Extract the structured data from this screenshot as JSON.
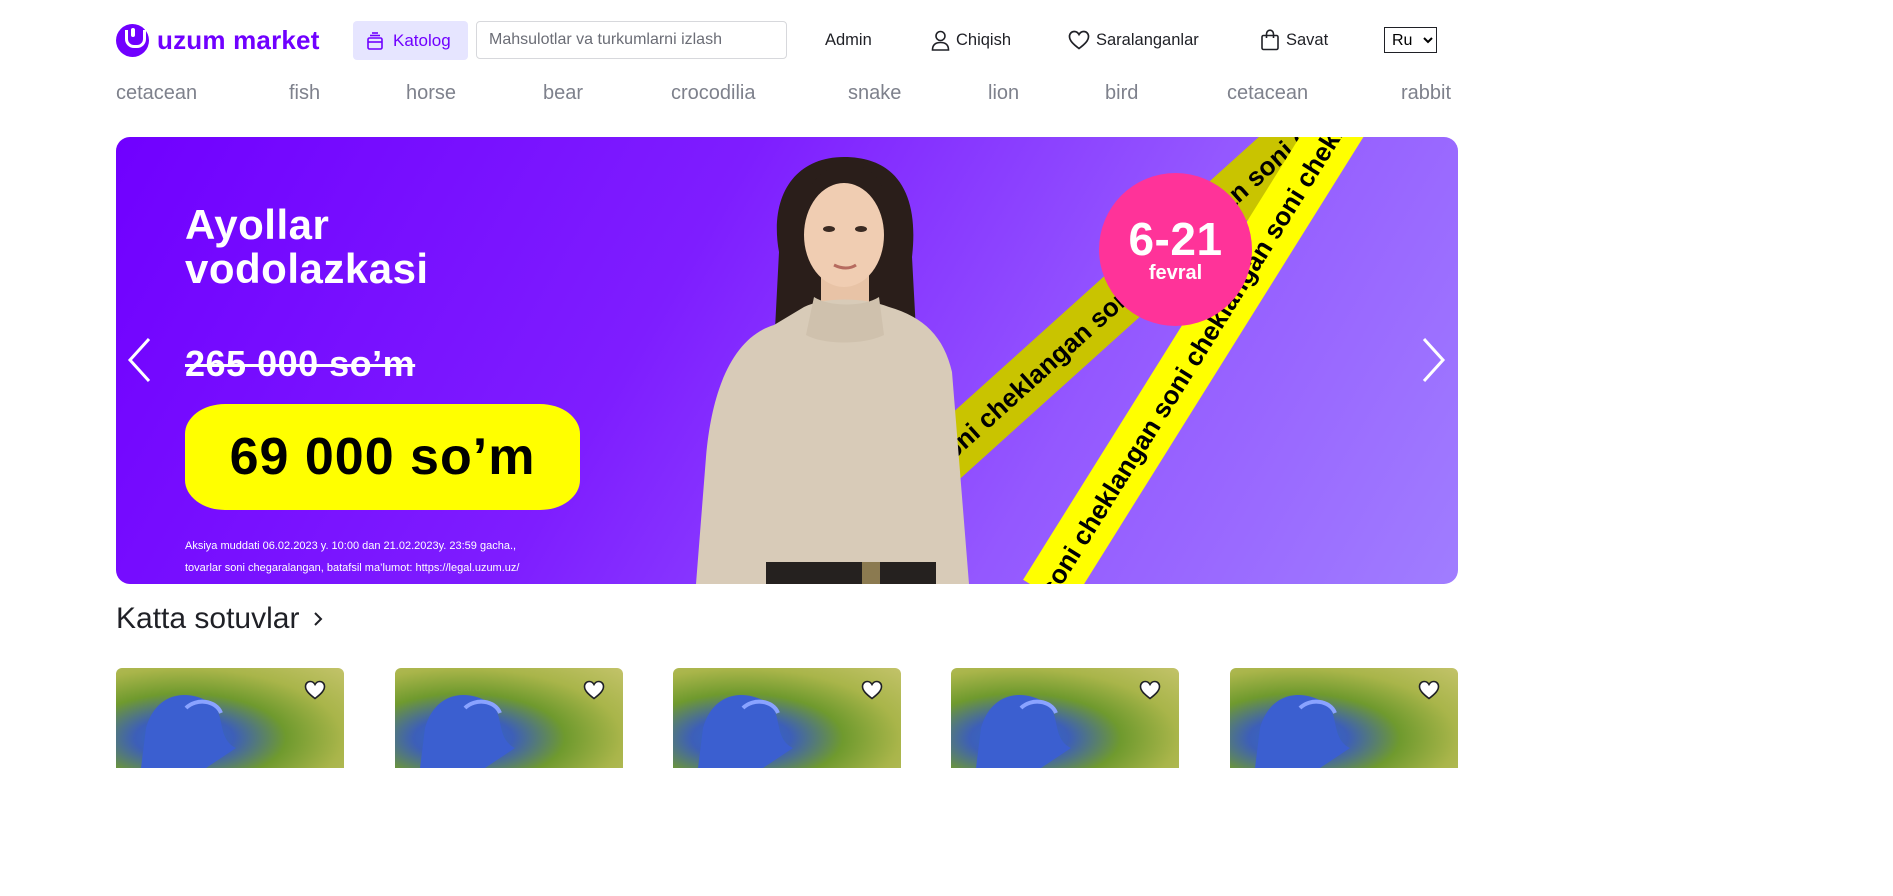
{
  "header": {
    "logo_text": "uzum market",
    "catalog_label": "Katolog",
    "search_placeholder": "Mahsulotlar va turkumlarni izlash",
    "admin_label": "Admin",
    "logout_label": "Chiqish",
    "favorites_label": "Saralanganlar",
    "cart_label": "Savat",
    "language": {
      "selected": "Ru"
    }
  },
  "categories": [
    "cetacean",
    "fish",
    "horse",
    "bear",
    "crocodilia",
    "snake",
    "lion",
    "bird",
    "cetacean",
    "rabbit"
  ],
  "banner": {
    "title_line1": "Ayollar",
    "title_line2": "vodolazkasi",
    "old_price": "265 000 so’m",
    "new_price": "69 000 so’m",
    "legal_line1": "Aksiya muddati 06.02.2023 y. 10:00 dan 21.02.2023y. 23:59 gacha.,",
    "legal_line2": "tovarlar soni chegaralangan, batafsil ma’lumot: https://legal.uzum.uz/",
    "date_range": "6-21",
    "date_month": "fevral",
    "tape_text": "soni cheklangan   soni cheklangan   soni cheklangan",
    "colors": {
      "primary": "#7000ff",
      "price_bg": "#ffff00",
      "date_circle": "#ff3399"
    }
  },
  "section": {
    "title": "Katta sotuvlar"
  },
  "products": [
    {
      "id": "p1"
    },
    {
      "id": "p2"
    },
    {
      "id": "p3"
    },
    {
      "id": "p4"
    },
    {
      "id": "p5"
    }
  ],
  "icons": {
    "catalog": "catalog-icon",
    "user": "user-icon",
    "heart": "heart-icon",
    "bag": "bag-icon",
    "prev": "chevron-left-icon",
    "next": "chevron-right-icon",
    "section_arrow": "chevron-right-icon"
  }
}
